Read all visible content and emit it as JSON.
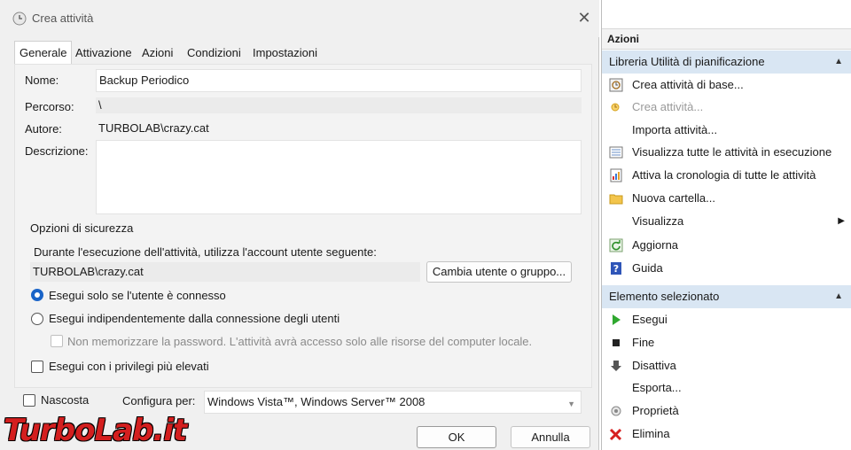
{
  "dialog": {
    "title": "Crea attività",
    "tabs": [
      {
        "label": "Generale"
      },
      {
        "label": "Attivazione"
      },
      {
        "label": "Azioni"
      },
      {
        "label": "Condizioni"
      },
      {
        "label": "Impostazioni"
      }
    ],
    "general": {
      "name_label": "Nome:",
      "name_value": "Backup Periodico",
      "path_label": "Percorso:",
      "path_value": "\\",
      "author_label": "Autore:",
      "author_value": "TURBOLAB\\crazy.cat",
      "description_label": "Descrizione:",
      "description_value": ""
    },
    "security": {
      "group_title": "Opzioni di sicurezza",
      "account_prompt": "Durante l'esecuzione dell'attività, utilizza l'account utente seguente:",
      "account_value": "TURBOLAB\\crazy.cat",
      "change_button": "Cambia utente o gruppo...",
      "radio_logged_on": "Esegui solo se l'utente è connesso",
      "radio_any": "Esegui indipendentemente dalla connessione degli utenti",
      "no_store_password": "Non memorizzare la password. L'attività avrà accesso solo alle risorse del computer locale.",
      "highest_privileges": "Esegui con i privilegi più elevati"
    },
    "hidden_label": "Nascosta",
    "configure_label": "Configura per:",
    "configure_value": "Windows Vista™, Windows Server™ 2008",
    "ok_button": "OK",
    "cancel_button": "Annulla"
  },
  "actions_pane": {
    "header": "Azioni",
    "library_section": "Libreria Utilità di pianificazione",
    "library_items": [
      {
        "label": "Crea attività di base...",
        "icon": "wizard-icon"
      },
      {
        "label": "Crea attività...",
        "icon": "create-task-icon"
      },
      {
        "label": "Importa attività...",
        "icon": "none"
      },
      {
        "label": "Visualizza tutte le attività in esecuzione",
        "icon": "running-tasks-icon"
      },
      {
        "label": "Attiva la cronologia di tutte le attività",
        "icon": "history-icon"
      },
      {
        "label": "Nuova cartella...",
        "icon": "folder-icon"
      },
      {
        "label": "Visualizza",
        "icon": "none"
      },
      {
        "label": "Aggiorna",
        "icon": "refresh-icon"
      },
      {
        "label": "Guida",
        "icon": "help-icon"
      }
    ],
    "selected_section": "Elemento selezionato",
    "selected_items": [
      {
        "label": "Esegui",
        "icon": "run-icon"
      },
      {
        "label": "Fine",
        "icon": "stop-icon"
      },
      {
        "label": "Disattiva",
        "icon": "disable-icon"
      },
      {
        "label": "Esporta...",
        "icon": "none"
      },
      {
        "label": "Proprietà",
        "icon": "properties-icon"
      },
      {
        "label": "Elimina",
        "icon": "delete-icon"
      }
    ]
  },
  "watermark": "TurboLab.it"
}
